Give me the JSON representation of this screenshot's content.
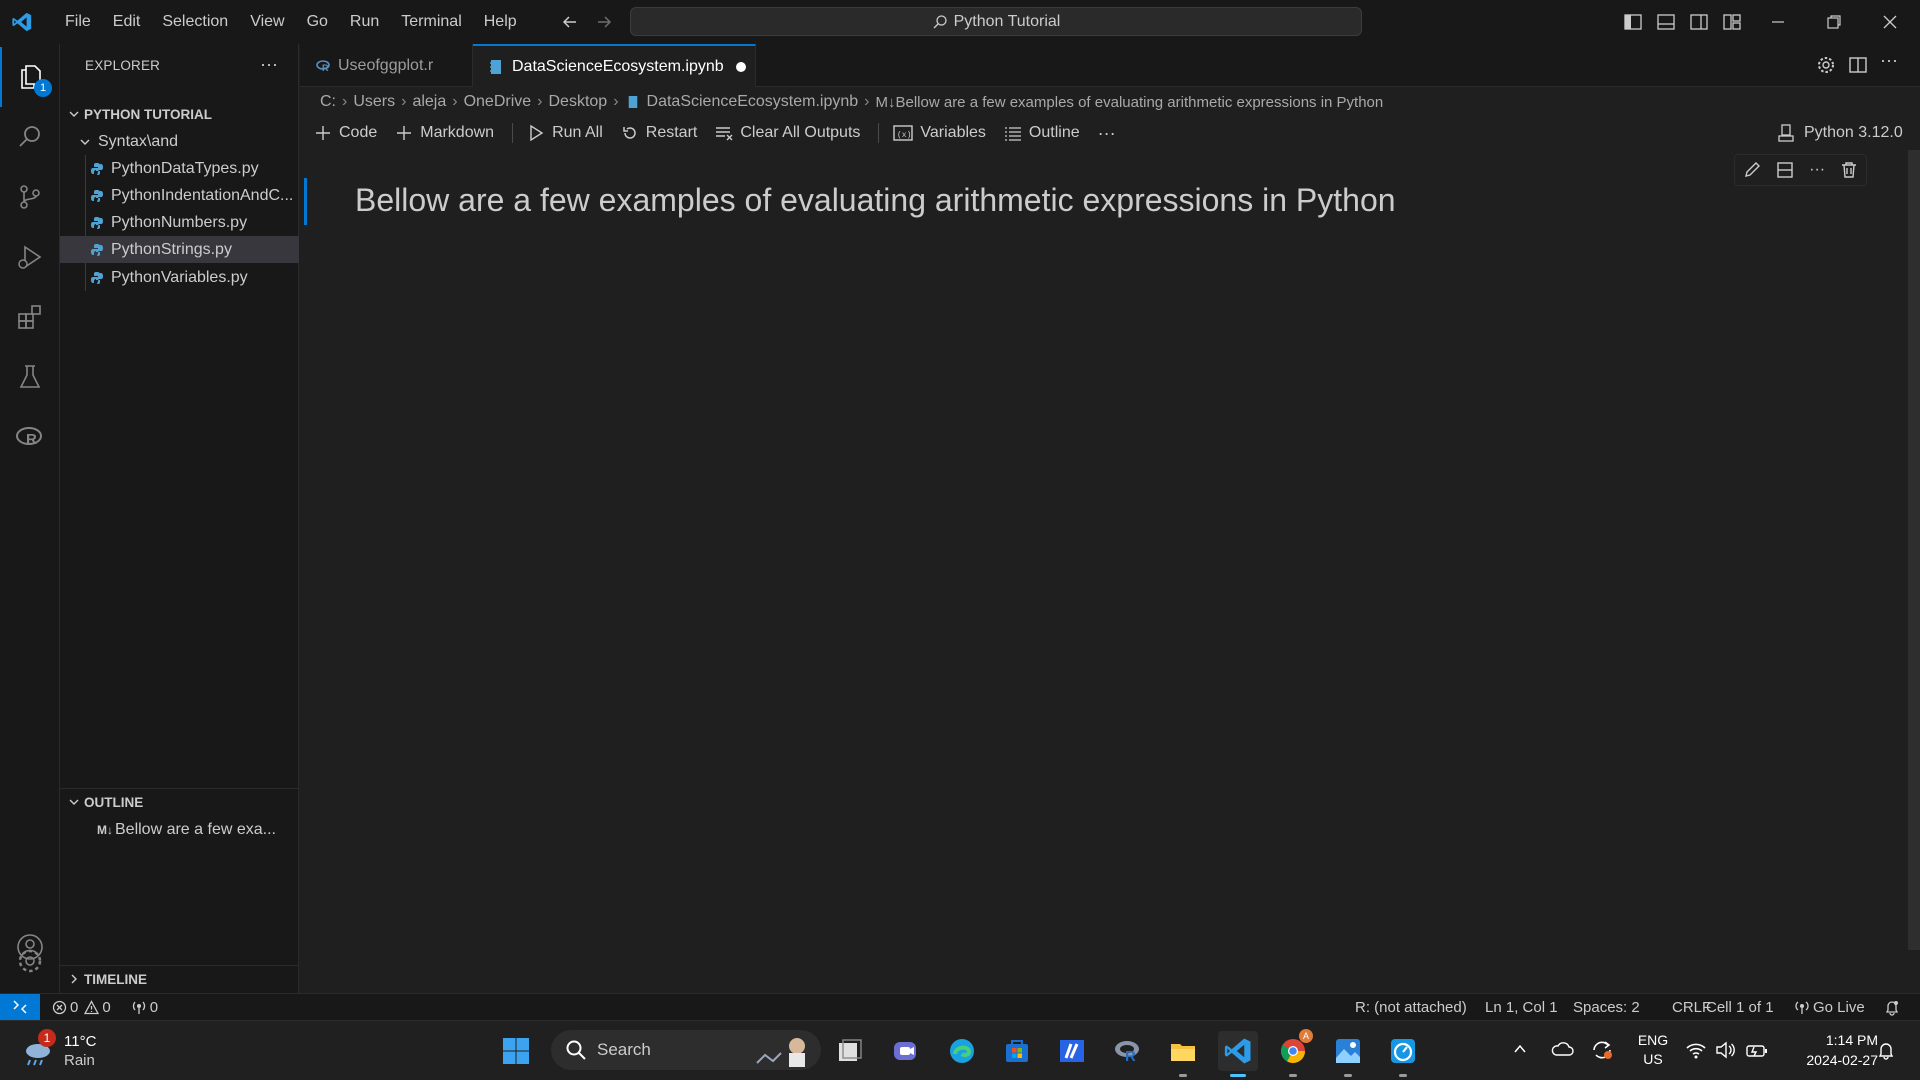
{
  "titlebar": {
    "menu": [
      "File",
      "Edit",
      "Selection",
      "View",
      "Go",
      "Run",
      "Terminal",
      "Help"
    ],
    "command_center": "Python Tutorial"
  },
  "activity": {
    "explorer_badge": "1"
  },
  "sidebar": {
    "title": "EXPLORER",
    "folder": "PYTHON TUTORIAL",
    "subfolder": "Syntax\\and",
    "files": [
      "PythonDataTypes.py",
      "PythonIndentationAndC...",
      "PythonNumbers.py",
      "PythonStrings.py",
      "PythonVariables.py"
    ],
    "selected_file": "PythonStrings.py",
    "outline_title": "OUTLINE",
    "outline_item_prefix": "M↓",
    "outline_item": "Bellow are a few exa...",
    "timeline_title": "TIMELINE"
  },
  "tabs": [
    {
      "label": "Useofggplot.r",
      "active": false
    },
    {
      "label": "DataScienceEcosystem.ipynb",
      "active": true,
      "dirty": true
    }
  ],
  "breadcrumb": [
    "C:",
    "Users",
    "aleja",
    "OneDrive",
    "Desktop",
    "DataScienceEcosystem.ipynb",
    "M↓Bellow are a few examples of evaluating arithmetic expressions in Python"
  ],
  "toolbar": {
    "code": "Code",
    "markdown": "Markdown",
    "run_all": "Run All",
    "restart": "Restart",
    "clear_outputs": "Clear All Outputs",
    "variables": "Variables",
    "outline": "Outline",
    "more": "···",
    "kernel": "Python 3.12.0"
  },
  "cell": {
    "text": "Bellow are a few examples of evaluating arithmetic expressions in Python"
  },
  "statusbar": {
    "errors": "0",
    "warnings": "0",
    "ports": "0",
    "r_status": "R: (not attached)",
    "position": "Ln 1, Col 1",
    "spaces": "Spaces: 2",
    "eol": "CRLF",
    "cell": "Cell 1 of 1",
    "go_live": "Go Live"
  },
  "taskbar": {
    "weather_temp": "11°C",
    "weather_desc": "Rain",
    "weather_badge": "1",
    "search": "Search",
    "lang_top": "ENG",
    "lang_bottom": "US",
    "time": "1:14 PM",
    "date": "2024-02-27"
  },
  "colors": {
    "accent": "#0078d4",
    "background": "#1f1f1f",
    "sidebar": "#181818",
    "python_icon": "#4fa3d4",
    "dirty_dot": "#ffffff"
  }
}
